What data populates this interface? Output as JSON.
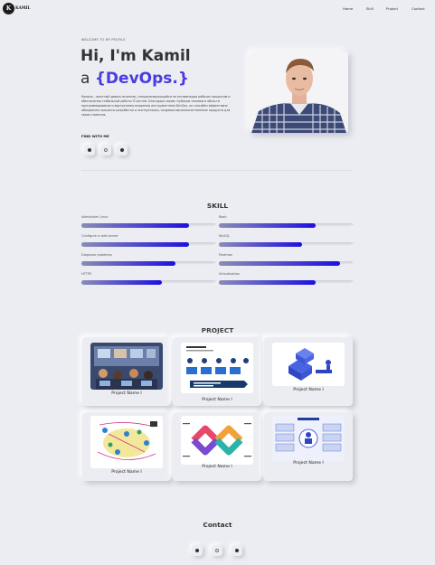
{
  "header": {
    "logo_letter": "K",
    "logo_text": "KAMIL",
    "nav": [
      "Home",
      "Skill",
      "Project",
      "Contact"
    ]
  },
  "hero": {
    "welcome": "WELCOME TO MY PROFILE",
    "greeting": "Hi, I'm Kamil",
    "role_prefix": "a ",
    "role": "{DevOps.}",
    "bio": "Камиль – опытный девопс-инженер, специализирующийся на оптимизации рабочих процессов и обеспечении стабильной работы IT-систем. Благодаря своим глубоким знаниям в области программирования и виртуозному владению инструментами DevOps, он способен эффективно объединить процессы разработки и эксплуатации, создавая высококачественные продукты для своих клиентов.",
    "find_label": "FIND WITH ME",
    "social_icons": [
      "github-icon",
      "instagram-icon",
      "telegram-icon"
    ]
  },
  "skill": {
    "title": "SKILL",
    "items": [
      {
        "label": "Administer Linux",
        "level": 0.8
      },
      {
        "label": "Bash",
        "level": 0.72
      },
      {
        "label": "Configure a web server",
        "level": 0.8
      },
      {
        "label": "MySQL",
        "level": 0.62
      },
      {
        "label": "Diagnose problems",
        "level": 0.7
      },
      {
        "label": "Postman",
        "level": 0.9
      },
      {
        "label": "HTTPS",
        "level": 0.6
      },
      {
        "label": "Virtualization",
        "level": 0.72
      }
    ]
  },
  "project": {
    "title": "PROJECT",
    "items": [
      {
        "name": "Project Name I"
      },
      {
        "name": "Project Name I"
      },
      {
        "name": "Project Name I"
      },
      {
        "name": "Project Name I"
      },
      {
        "name": "Project Name I"
      },
      {
        "name": "Project Name I"
      }
    ]
  },
  "contact": {
    "title": "Contact",
    "icons": [
      "github-icon",
      "instagram-icon",
      "telegram-icon"
    ]
  },
  "colors": {
    "background": "#ecedf2",
    "accent": "#4a3ce0",
    "bar_start": "#8a8cb5",
    "bar_end": "#1e0fe0"
  }
}
